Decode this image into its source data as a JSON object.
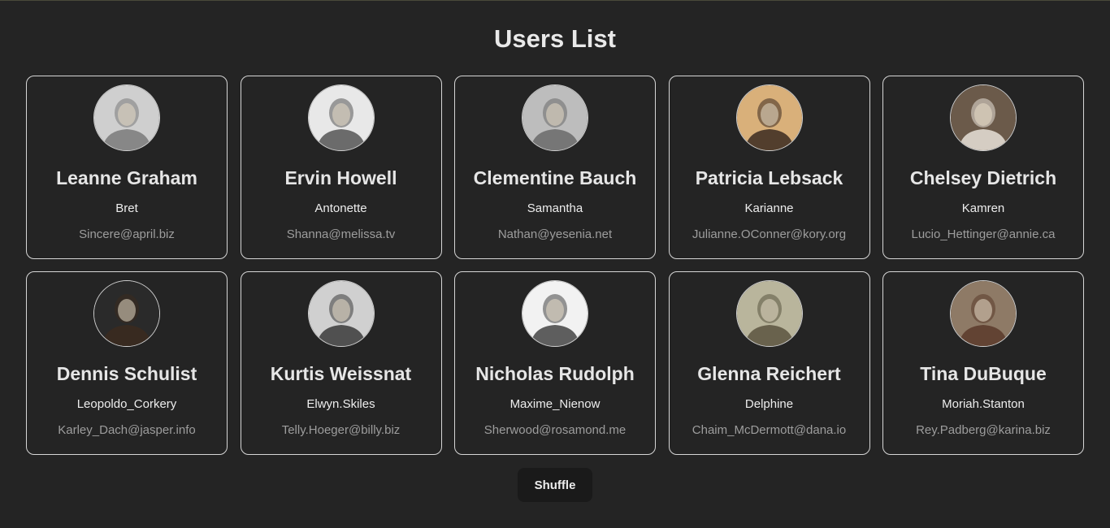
{
  "page": {
    "title": "Users List"
  },
  "users": [
    {
      "name": "Leanne Graham",
      "username": "Bret",
      "email": "Sincere@april.biz",
      "avatar_tone": "#7a7a7a",
      "avatar_bg": "#cfcfcf"
    },
    {
      "name": "Ervin Howell",
      "username": "Antonette",
      "email": "Shanna@melissa.tv",
      "avatar_tone": "#555555",
      "avatar_bg": "#e8e8e8"
    },
    {
      "name": "Clementine Bauch",
      "username": "Samantha",
      "email": "Nathan@yesenia.net",
      "avatar_tone": "#6a6a6a",
      "avatar_bg": "#bdbdbd"
    },
    {
      "name": "Patricia Lebsack",
      "username": "Karianne",
      "email": "Julianne.OConner@kory.org",
      "avatar_tone": "#3a2a20",
      "avatar_bg": "#d9b07a"
    },
    {
      "name": "Chelsey Dietrich",
      "username": "Kamren",
      "email": "Lucio_Hettinger@annie.ca",
      "avatar_tone": "#e7e2d8",
      "avatar_bg": "#6b5a4a"
    },
    {
      "name": "Dennis Schulist",
      "username": "Leopoldo_Corkery",
      "email": "Karley_Dach@jasper.info",
      "avatar_tone": "#3b2a1e",
      "avatar_bg": "#2a2a2a"
    },
    {
      "name": "Kurtis Weissnat",
      "username": "Elwyn.Skiles",
      "email": "Telly.Hoeger@billy.biz",
      "avatar_tone": "#3a3a3a",
      "avatar_bg": "#d0d0d0"
    },
    {
      "name": "Nicholas Rudolph",
      "username": "Maxime_Nienow",
      "email": "Sherwood@rosamond.me",
      "avatar_tone": "#444444",
      "avatar_bg": "#f2f2f2"
    },
    {
      "name": "Glenna Reichert",
      "username": "Delphine",
      "email": "Chaim_McDermott@dana.io",
      "avatar_tone": "#5a5440",
      "avatar_bg": "#b9b59c"
    },
    {
      "name": "Tina DuBuque",
      "username": "Moriah.Stanton",
      "email": "Rey.Padberg@karina.biz",
      "avatar_tone": "#5a3a2a",
      "avatar_bg": "#8e7a66"
    }
  ],
  "actions": {
    "shuffle_label": "Shuffle"
  }
}
